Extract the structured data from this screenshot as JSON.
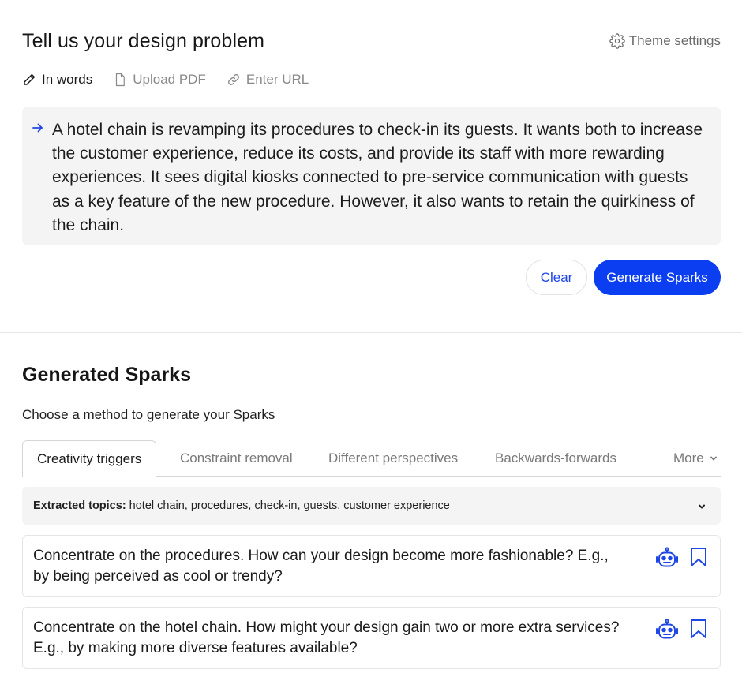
{
  "header": {
    "title": "Tell us your design problem",
    "theme_settings_label": "Theme settings"
  },
  "input_modes": [
    {
      "label": "In words",
      "icon": "pencil-icon",
      "active": true
    },
    {
      "label": "Upload PDF",
      "icon": "document-icon",
      "active": false
    },
    {
      "label": "Enter URL",
      "icon": "link-icon",
      "active": false
    }
  ],
  "problem": {
    "text": "A hotel chain is revamping its procedures to check-in its guests. It wants both to increase the customer experience, reduce its costs, and provide its staff with more rewarding experiences. It sees digital kiosks connected to pre-service communication with guests as a key feature of the new procedure. However, it also wants to retain the quirkiness of the chain."
  },
  "actions": {
    "clear_label": "Clear",
    "generate_label": "Generate Sparks"
  },
  "sparks": {
    "title": "Generated Sparks",
    "subtitle": "Choose a method to generate your Sparks",
    "tabs": [
      {
        "label": "Creativity triggers",
        "active": true
      },
      {
        "label": "Constraint removal",
        "active": false
      },
      {
        "label": "Different perspectives",
        "active": false
      },
      {
        "label": "Backwards-forwards",
        "active": false
      },
      {
        "label": "More",
        "active": false
      }
    ],
    "topics_label": "Extracted topics:",
    "topics_value": "hotel chain, procedures, check-in, guests, customer experience",
    "cards": [
      {
        "text": "Concentrate on the procedures. How can your design become more fashionable? E.g., by being perceived as cool or trendy?"
      },
      {
        "text": "Concentrate on the hotel chain. How might your design gain two or more extra services? E.g., by making more diverse features available?"
      }
    ]
  },
  "colors": {
    "accent": "#0a3ef0",
    "accent_text": "#1f47e6",
    "panel_bg": "#f4f4f4"
  }
}
